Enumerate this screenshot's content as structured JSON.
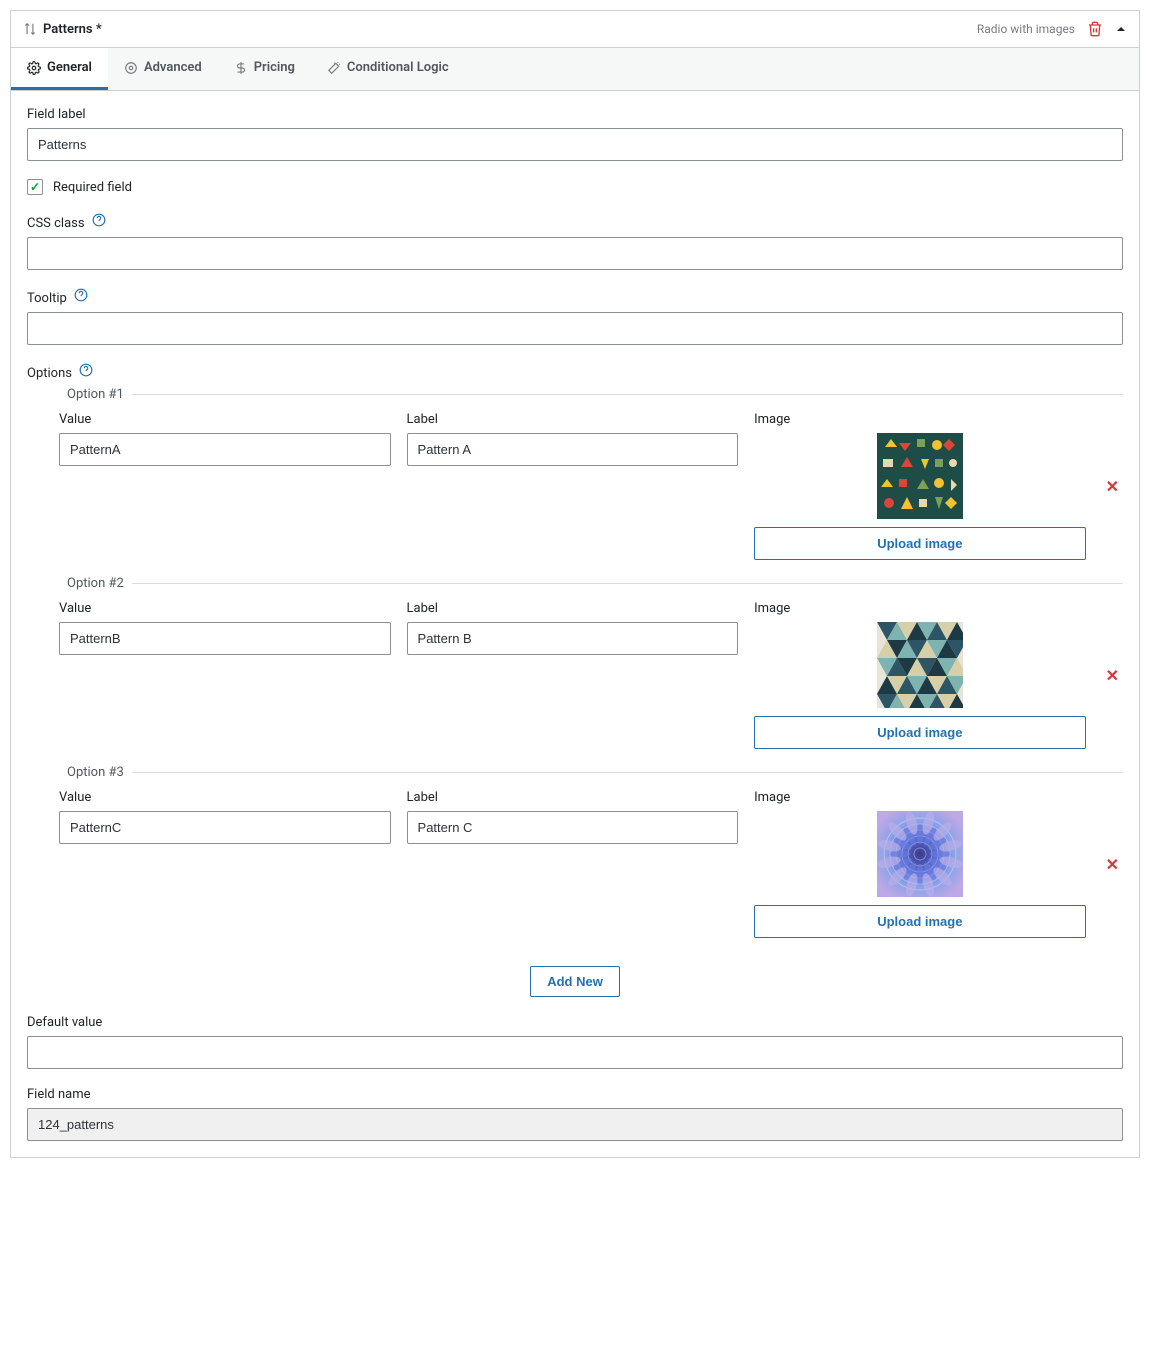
{
  "header": {
    "title": "Patterns *",
    "type_label": "Radio with images"
  },
  "tabs": [
    {
      "label": "General",
      "icon": "gear-icon",
      "active": true
    },
    {
      "label": "Advanced",
      "icon": "sliders-icon",
      "active": false
    },
    {
      "label": "Pricing",
      "icon": "dollar-icon",
      "active": false
    },
    {
      "label": "Conditional Logic",
      "icon": "wand-icon",
      "active": false
    }
  ],
  "form": {
    "field_label_caption": "Field label",
    "field_label_value": "Patterns",
    "required_checked": true,
    "required_label": "Required field",
    "css_class_caption": "CSS class",
    "css_class_value": "",
    "tooltip_caption": "Tooltip",
    "tooltip_value": "",
    "options_caption": "Options",
    "option_value_caption": "Value",
    "option_label_caption": "Label",
    "option_image_caption": "Image",
    "upload_image_label": "Upload image",
    "add_new_label": "Add New",
    "default_value_caption": "Default value",
    "default_value_value": "",
    "field_name_caption": "Field name",
    "field_name_value": "124_patterns",
    "options": [
      {
        "legend": "Option #1",
        "value": "PatternA",
        "label": "Pattern A"
      },
      {
        "legend": "Option #2",
        "value": "PatternB",
        "label": "Pattern B"
      },
      {
        "legend": "Option #3",
        "value": "PatternC",
        "label": "Pattern C"
      }
    ]
  },
  "colors": {
    "primary": "#2271b1",
    "danger": "#d63638"
  }
}
